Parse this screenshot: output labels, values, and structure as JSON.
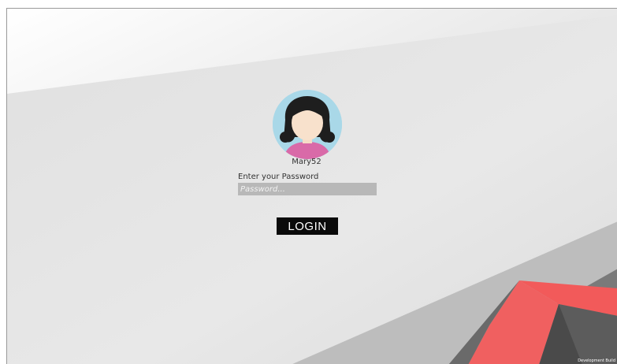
{
  "user": {
    "name": "Mary52",
    "avatar_icon": "girl-avatar-icon"
  },
  "password": {
    "label": "Enter your Password",
    "placeholder": "Password...",
    "value": ""
  },
  "login_button": {
    "label": "LOGIN"
  },
  "footer": {
    "dev_note": "Development Build"
  },
  "colors": {
    "background_light": "#f4f4f4",
    "background_mid": "#e2e2e2",
    "accent_red": "#f25a5a",
    "shape_dark": "#585858",
    "button_bg": "#0a0a0a",
    "input_bg": "#b8b8b8"
  }
}
